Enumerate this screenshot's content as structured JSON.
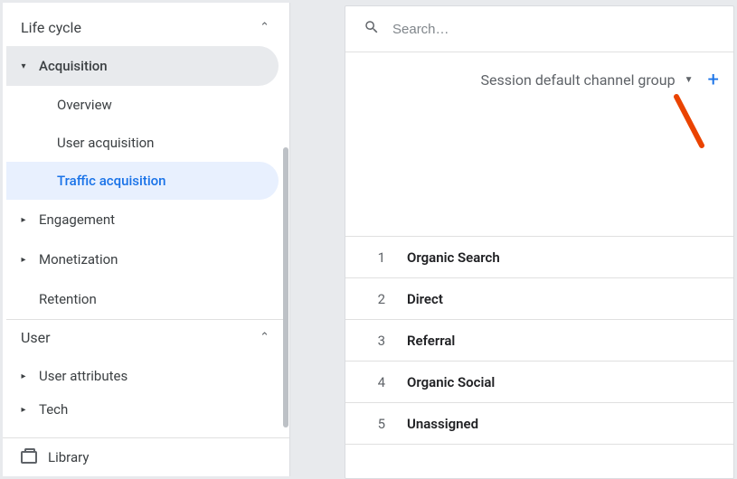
{
  "sidebar": {
    "section1": {
      "title": "Life cycle"
    },
    "items": [
      {
        "label": "Acquisition"
      },
      {
        "label": "Overview"
      },
      {
        "label": "User acquisition"
      },
      {
        "label": "Traffic acquisition"
      },
      {
        "label": "Engagement"
      },
      {
        "label": "Monetization"
      },
      {
        "label": "Retention"
      }
    ],
    "section2": {
      "title": "User"
    },
    "items2": [
      {
        "label": "User attributes"
      },
      {
        "label": "Tech"
      }
    ],
    "library": "Library"
  },
  "search": {
    "placeholder": "Search…"
  },
  "dimension": {
    "label": "Session default channel group"
  },
  "rows": [
    {
      "n": "1",
      "v": "Organic Search"
    },
    {
      "n": "2",
      "v": "Direct"
    },
    {
      "n": "3",
      "v": "Referral"
    },
    {
      "n": "4",
      "v": "Organic Social"
    },
    {
      "n": "5",
      "v": "Unassigned"
    }
  ]
}
